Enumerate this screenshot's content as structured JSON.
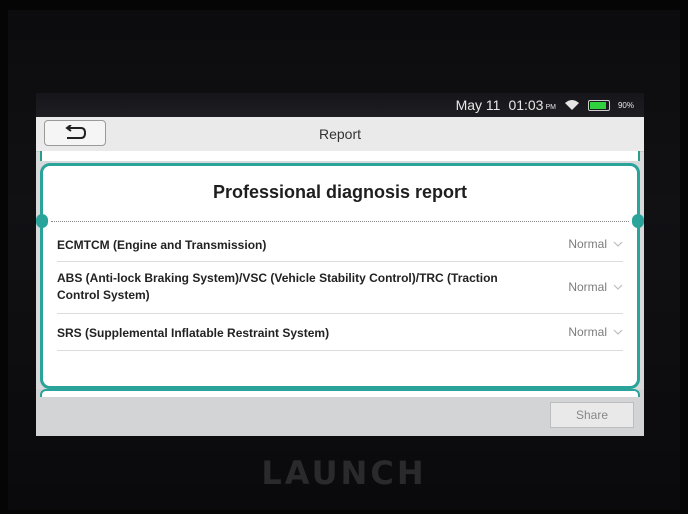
{
  "status": {
    "date": "May 11",
    "time": "01:03",
    "ampm": "PM",
    "battery": "90%"
  },
  "header": {
    "title": "Report"
  },
  "report": {
    "heading": "Professional diagnosis report",
    "items": [
      {
        "label": "ECMTCM (Engine and Transmission)",
        "status": "Normal"
      },
      {
        "label": "ABS (Anti-lock Braking System)/VSC (Vehicle Stability Control)/TRC (Traction Control System)",
        "status": "Normal"
      },
      {
        "label": "SRS (Supplemental Inflatable Restraint System)",
        "status": "Normal"
      }
    ]
  },
  "footer": {
    "share_label": "Share"
  },
  "device": {
    "brand": "LAUNCH"
  },
  "colors": {
    "accent": "#2aa39a",
    "battery": "#2fd13f"
  }
}
